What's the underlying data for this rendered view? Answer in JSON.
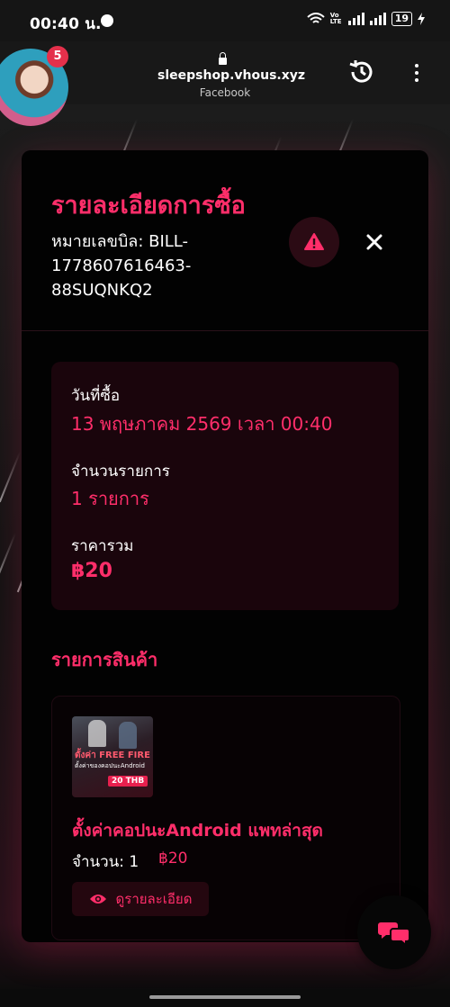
{
  "status_bar": {
    "time": "00:40 น.",
    "volte": "Vo LTE",
    "battery": "19"
  },
  "browser": {
    "url": "sleepshop.vhous.xyz",
    "subtitle": "Facebook",
    "notification_count": "5"
  },
  "modal": {
    "title": "รายละเอียดการซื้อ",
    "bill_number": "หมายเลขบิล: BILL-1778607616463-88SUQNKQ2",
    "purchase_date_label": "วันที่ซื้อ",
    "purchase_date_value": "13 พฤษภาคม 2569 เวลา 00:40",
    "item_count_label": "จำนวนรายการ",
    "item_count_value": "1 รายการ",
    "total_label": "ราคารวม",
    "total_value": "฿20",
    "products_title": "รายการสินค้า"
  },
  "product": {
    "name": "ตั้งค่าคอปนะAndroid แพทล่าสุด",
    "quantity": "จำนวน: 1",
    "price": "฿20",
    "view_details_label": "ดูรายละเอียด",
    "thumb_title": "ตั้งค่า FREE FIRE",
    "thumb_subtitle": "ตั้งค่าของคอปนะAndroid",
    "thumb_price": "20 THB"
  },
  "colors": {
    "accent": "#ff2e6a",
    "card_bg": "#1a050c",
    "modal_bg": "#020202"
  },
  "icons": {
    "warning": "warning-triangle-icon",
    "close": "close-icon",
    "eye": "eye-icon",
    "chat": "chat-bubbles-icon",
    "history": "history-icon",
    "more": "more-vertical-icon",
    "lock": "lock-icon"
  }
}
